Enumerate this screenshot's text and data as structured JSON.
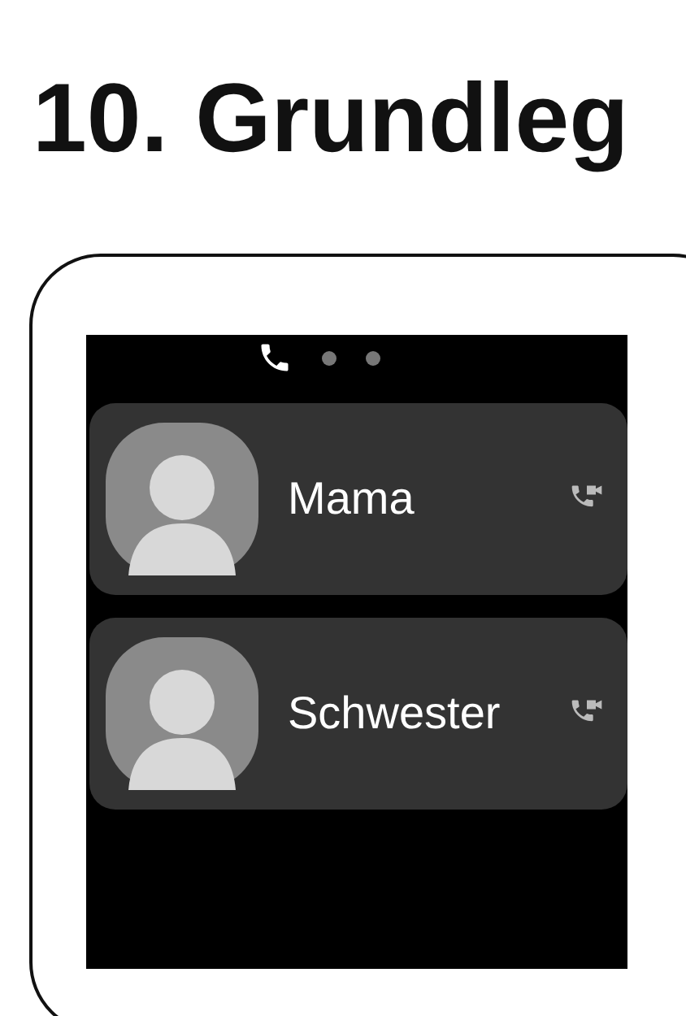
{
  "heading": "10. Grundleg",
  "pager": [
    {
      "kind": "phone",
      "selected": true
    },
    {
      "kind": "dot",
      "selected": false
    },
    {
      "kind": "dot",
      "selected": false
    }
  ],
  "contacts": [
    {
      "name": "Mama"
    },
    {
      "name": "Schwester"
    }
  ]
}
